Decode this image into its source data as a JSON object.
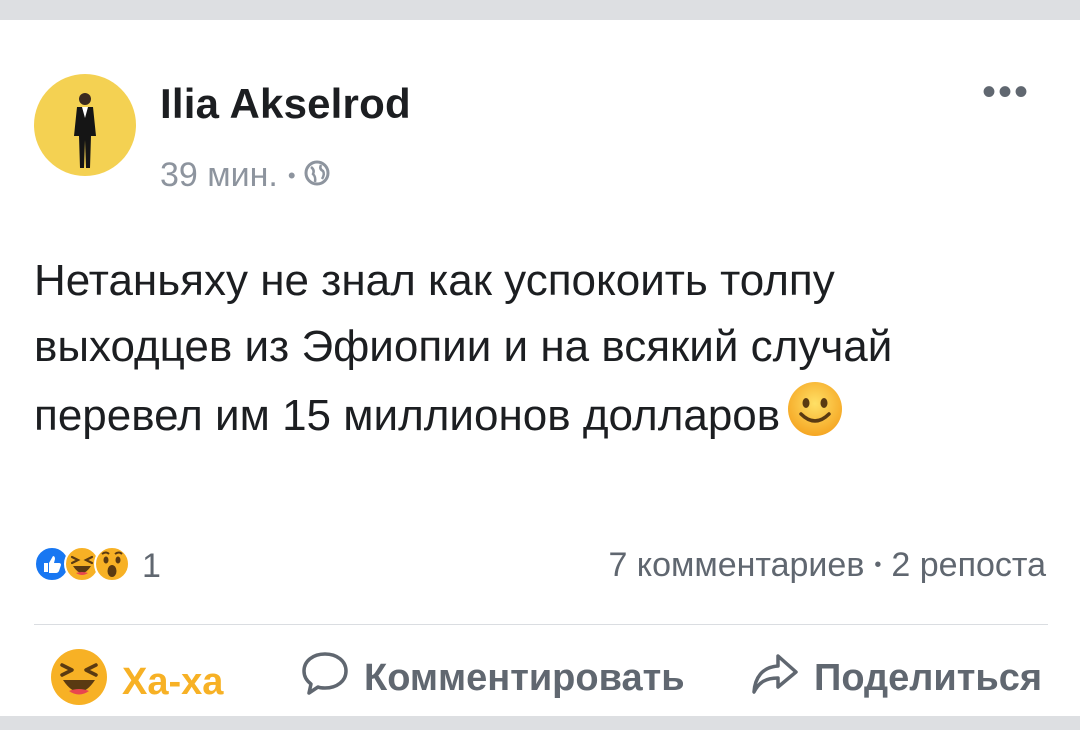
{
  "post": {
    "author": "Ilia Akselrod",
    "time": "39 мин.",
    "separator": "•",
    "more_label": "•••",
    "text": "Нетаньяху не знал как успокоить толпу выходцев из Эфиопии и на всякий случай перевел им 15 миллионов долларов"
  },
  "reactions": {
    "icons": [
      "like-reaction-icon",
      "haha-reaction-icon",
      "wow-reaction-icon"
    ],
    "count": "1"
  },
  "stats": {
    "comments": "7 комментариев",
    "separator": "•",
    "shares": "2 репоста"
  },
  "actions": {
    "haha": "Ха-ха",
    "comment": "Комментировать",
    "share": "Поделиться"
  },
  "colors": {
    "like_blue": "#1877f2",
    "haha_yellow": "#f7b125",
    "text_dark": "#1c1e21",
    "text_gray": "#606770"
  }
}
